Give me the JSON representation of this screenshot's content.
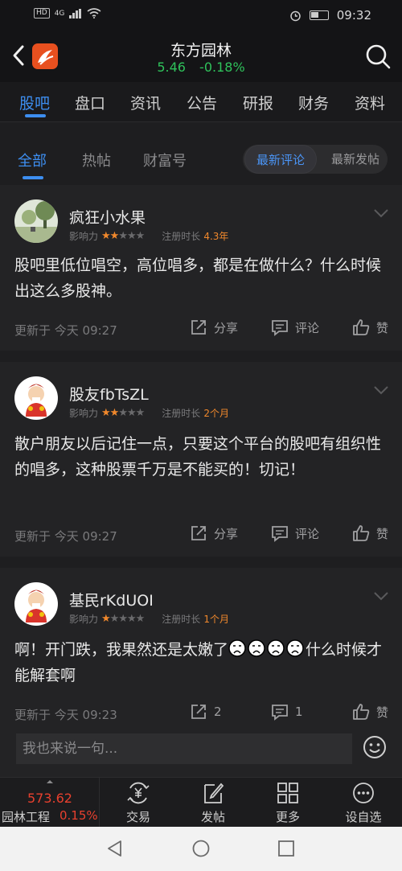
{
  "status_bar": {
    "network": "4G",
    "time": "09:32"
  },
  "header": {
    "stock_name": "东方园林",
    "price": "5.46",
    "change": "-0.18%"
  },
  "main_tabs": [
    "股吧",
    "盘口",
    "资讯",
    "公告",
    "研报",
    "财务",
    "资料"
  ],
  "sub_tabs": [
    "全部",
    "热帖",
    "财富号"
  ],
  "sort_options": [
    "最新评论",
    "最新发帖"
  ],
  "meta_labels": {
    "influence": "影响力",
    "reg_duration": "注册时长"
  },
  "posts": [
    {
      "user": "疯狂小水果",
      "stars": 2,
      "reg": "4.3年",
      "content": "股吧里低位唱空，高位唱多，都是在做什么？什么时候出这么多股神。",
      "time": "更新于 今天 09:27",
      "share": "分享",
      "comment": "评论",
      "like": "赞"
    },
    {
      "user": "股友fbTsZL",
      "stars": 2,
      "reg": "2个月",
      "content": "散户朋友以后记住一点，只要这个平台的股吧有组织性的唱多，这种股票千万是不能买的！切记！",
      "time": "更新于 今天 09:27",
      "share": "分享",
      "comment": "评论",
      "like": "赞"
    },
    {
      "user": "基民rKdUOI",
      "stars": 1,
      "reg": "1个月",
      "content_before": "啊！开门跌，我果然还是太嫩了",
      "content_after": "什么时候才能解套啊",
      "time": "更新于 今天 09:23",
      "share": "2",
      "comment": "1",
      "like": "赞"
    }
  ],
  "comment_bar": {
    "placeholder": "我也来说一句..."
  },
  "bottom_bar": {
    "index_value": "573.62",
    "index_name": "园林工程",
    "index_change": "0.15%",
    "items": [
      "交易",
      "发帖",
      "更多",
      "设自选"
    ]
  },
  "colors": {
    "accent": "#3d8ef0",
    "up": "#e8402e",
    "down": "#2fc25b",
    "star": "#f0882c"
  }
}
